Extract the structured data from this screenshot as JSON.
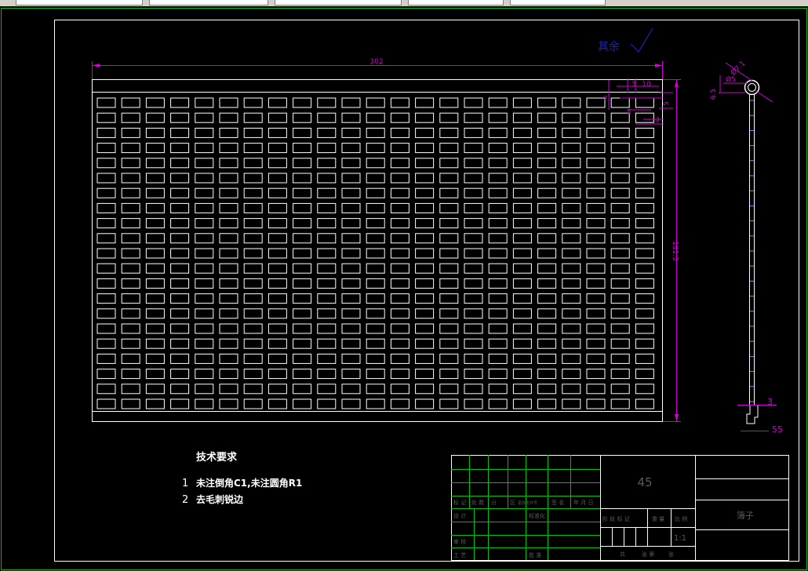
{
  "drawing": {
    "dims": {
      "overall_width": "302",
      "height": "181.5",
      "d3": "3",
      "d10": "10",
      "d5v": "5",
      "d5h": "5",
      "d3b": "3",
      "d2": "2",
      "hole_dia": "Ø7.1",
      "inner_dia": "Ø5",
      "d65": "6.5",
      "bottom3": "3",
      "bottom55": "55"
    },
    "roughness": "其余",
    "tech_req": {
      "title": "技术要求",
      "items": [
        {
          "num": "1",
          "text": "未注倒角C1,未注圆角R1"
        },
        {
          "num": "2",
          "text": "去毛刺锐边"
        }
      ]
    },
    "title_block": {
      "quantity": "45",
      "part_name": "簿子",
      "scale": "1:1",
      "row_marks": [
        "标 记",
        "处 数",
        "分",
        "区",
        "更改文件号",
        "签 名",
        "年 月 日"
      ],
      "design": "设 计",
      "standard": "标准化",
      "review": "审 核",
      "process": "工 艺",
      "approve": "批 准",
      "stage_labels": [
        "阶 段 标 记",
        "重 量",
        "比 例"
      ],
      "sheet": [
        "共",
        "张 第",
        "张"
      ]
    },
    "grid": {
      "rows": 21,
      "cols": 23
    }
  },
  "colors": {
    "outline": "#ffffff",
    "dimension": "#d000d0",
    "title_grid": "#00c000",
    "border": "#00c000"
  }
}
